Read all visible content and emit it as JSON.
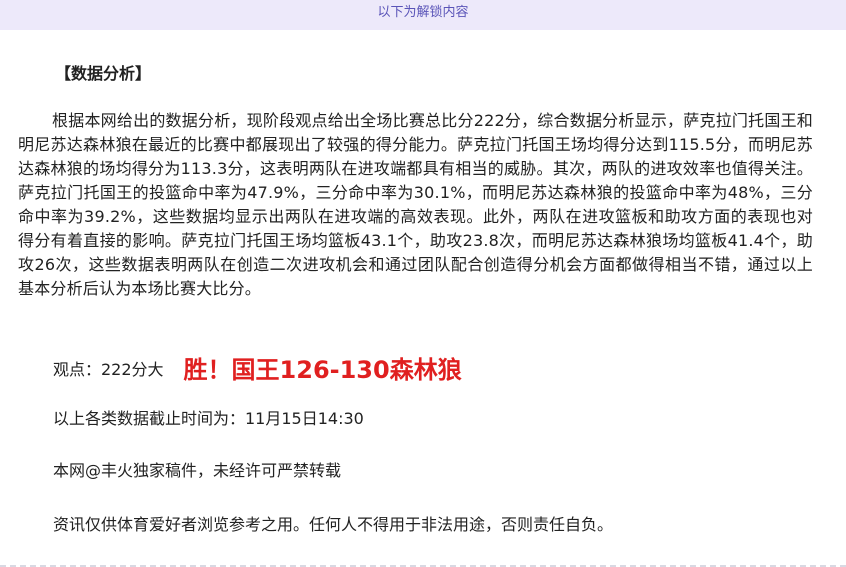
{
  "banner": {
    "text": "以下为解锁内容"
  },
  "article": {
    "section_title": "【数据分析】",
    "body": "根据本网给出的数据分析，现阶段观点给出全场比赛总比分222分，综合数据分析显示，萨克拉门托国王和明尼苏达森林狼在最近的比赛中都展现出了较强的得分能力。萨克拉门托国王场均得分达到115.5分，而明尼苏达森林狼的场均得分为113.3分，这表明两队在进攻端都具有相当的威胁。其次，两队的进攻效率也值得关注。萨克拉门托国王的投篮命中率为47.9%，三分命中率为30.1%，而明尼苏达森林狼的投篮命中率为48%，三分命中率为39.2%，这些数据均显示出两队在进攻端的高效表现。此外，两队在进攻篮板和助攻方面的表现也对得分有着直接的影响。萨克拉门托国王场均篮板43.1个，助攻23.8次，而明尼苏达森林狼场均篮板41.4个，助攻26次，这些数据表明两队在创造二次进攻机会和通过团队配合创造得分机会方面都做得相当不错，通过以上基本分析后认为本场比赛大比分。",
    "view_label": "观点：222分大",
    "result": "胜！国王126-130森林狼",
    "cutoff": "以上各类数据截止时间为：11月15日14:30",
    "copyright": "本网@丰火独家稿件，未经许可严禁转载",
    "disclaimer": "资讯仅供体育爱好者浏览参考之用。任何人不得用于非法用途，否则责任自负。"
  },
  "colors": {
    "banner_bg": "#ede9fa",
    "banner_text": "#5a54b8",
    "result_red": "#e02020"
  }
}
